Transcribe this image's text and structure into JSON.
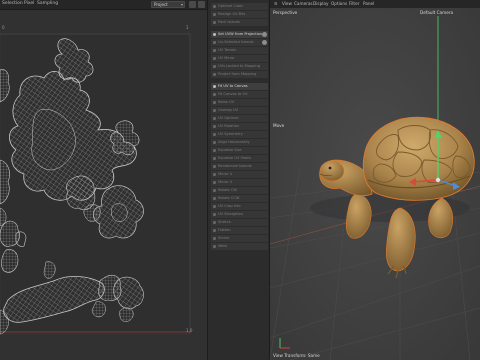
{
  "uv_editor": {
    "menus": [
      "Selection",
      "Pixel",
      "Sampling"
    ],
    "dropdown_value": "Project",
    "coord_top_left": "0",
    "coord_top_right": "1",
    "coord_bottom_right": "1,0"
  },
  "commands": {
    "items": [
      {
        "label": "Optimal Cubic",
        "active": false,
        "badge": false
      },
      {
        "label": "Realign UV Bits",
        "active": false,
        "badge": false
      },
      {
        "label": "Pack Islands",
        "active": false,
        "badge": false
      },
      {
        "label": "Set UVW from Projection",
        "active": true,
        "badge": true
      },
      {
        "label": "Un-Selected Islands",
        "active": false,
        "badge": true
      },
      {
        "label": "UV Terrain",
        "active": false,
        "badge": false
      },
      {
        "label": "UV Mirror",
        "active": false,
        "badge": false
      },
      {
        "label": "UVs Locked to Mapping",
        "active": false,
        "badge": false
      },
      {
        "label": "Project from Mapping",
        "active": false,
        "badge": false
      },
      {
        "label": "Fit UV to Canvas",
        "active": true,
        "badge": false
      },
      {
        "label": "Fit Canvas to UV",
        "active": false,
        "badge": false
      },
      {
        "label": "Relax UV",
        "active": false,
        "badge": false
      },
      {
        "label": "Unwrap UV",
        "active": false,
        "badge": false
      },
      {
        "label": "UV Optimal",
        "active": false,
        "badge": false
      },
      {
        "label": "UV Rotation",
        "active": false,
        "badge": false
      },
      {
        "label": "UV Symmetry",
        "active": false,
        "badge": false
      },
      {
        "label": "Align Horizontally",
        "active": false,
        "badge": false
      },
      {
        "label": "Equalize Size",
        "active": false,
        "badge": false
      },
      {
        "label": "Equalize UV Shells",
        "active": false,
        "badge": false
      },
      {
        "label": "Randomize Islands",
        "active": false,
        "badge": false
      },
      {
        "label": "Mirror U",
        "active": false,
        "badge": false
      },
      {
        "label": "Mirror V",
        "active": false,
        "badge": false
      },
      {
        "label": "Rotate CW",
        "active": false,
        "badge": false
      },
      {
        "label": "Rotate CCW",
        "active": false,
        "badge": false
      },
      {
        "label": "UV Crop Info",
        "active": false,
        "badge": false
      },
      {
        "label": "UV Straighten",
        "active": false,
        "badge": false
      },
      {
        "label": "Stretch",
        "active": false,
        "badge": false
      },
      {
        "label": "Flatten",
        "active": false,
        "badge": false
      },
      {
        "label": "Shrink",
        "active": false,
        "badge": false
      },
      {
        "label": "Weld",
        "active": false,
        "badge": false
      }
    ]
  },
  "viewport": {
    "menus": [
      "View",
      "Cameras",
      "Display",
      "Options",
      "Filter",
      "Panel"
    ],
    "projection": "Perspective",
    "camera": "Default Camera",
    "move_label": "Move",
    "status": "View Transform: Same",
    "colors": {
      "axis_x": "#d84a3a",
      "axis_y": "#4ed46a",
      "axis_z": "#4a8fd8",
      "model": "#b8925a"
    }
  }
}
